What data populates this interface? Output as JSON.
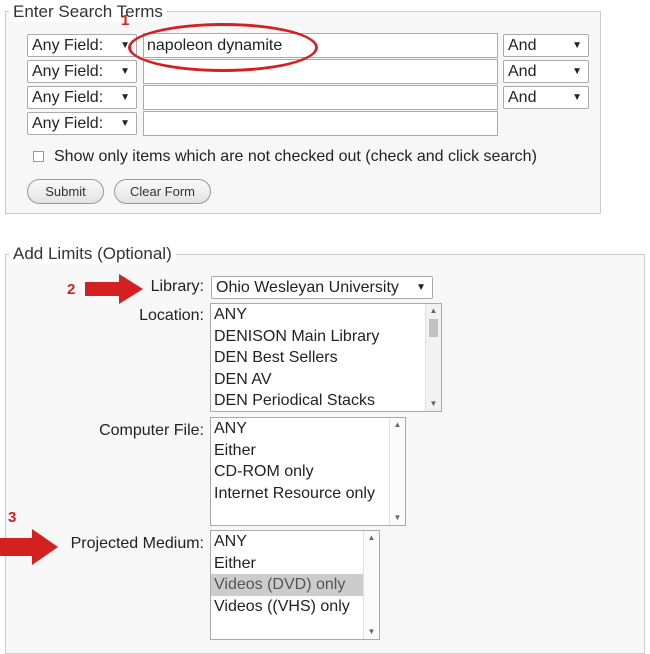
{
  "search": {
    "legend": "Enter Search Terms",
    "rows": [
      {
        "field": "Any Field:",
        "term": "napoleon dynamite",
        "op": "And"
      },
      {
        "field": "Any Field:",
        "term": "",
        "op": "And"
      },
      {
        "field": "Any Field:",
        "term": "",
        "op": "And"
      },
      {
        "field": "Any Field:",
        "term": ""
      }
    ],
    "checkbox_label": "Show only items which are not checked out (check and click search)",
    "checkbox_checked": false,
    "submit_label": "Submit",
    "clear_label": "Clear Form"
  },
  "limits": {
    "legend": "Add Limits (Optional)",
    "library_label": "Library:",
    "library_value": "Ohio Wesleyan University",
    "location_label": "Location:",
    "location_options": [
      "ANY",
      "DENISON Main Library",
      "DEN Best Sellers",
      "DEN AV",
      "DEN Periodical Stacks"
    ],
    "computer_file_label": "Computer File:",
    "computer_file_options": [
      "ANY",
      "Either",
      "CD-ROM only",
      "Internet Resource only"
    ],
    "projected_medium_label": "Projected Medium:",
    "projected_medium_options": [
      "ANY",
      "Either",
      "Videos (DVD) only",
      "Videos ((VHS) only"
    ],
    "projected_medium_selected": "Videos (DVD) only"
  },
  "annotations": {
    "marker_1": "1",
    "marker_2": "2",
    "marker_3": "3",
    "color": "#d32020"
  }
}
